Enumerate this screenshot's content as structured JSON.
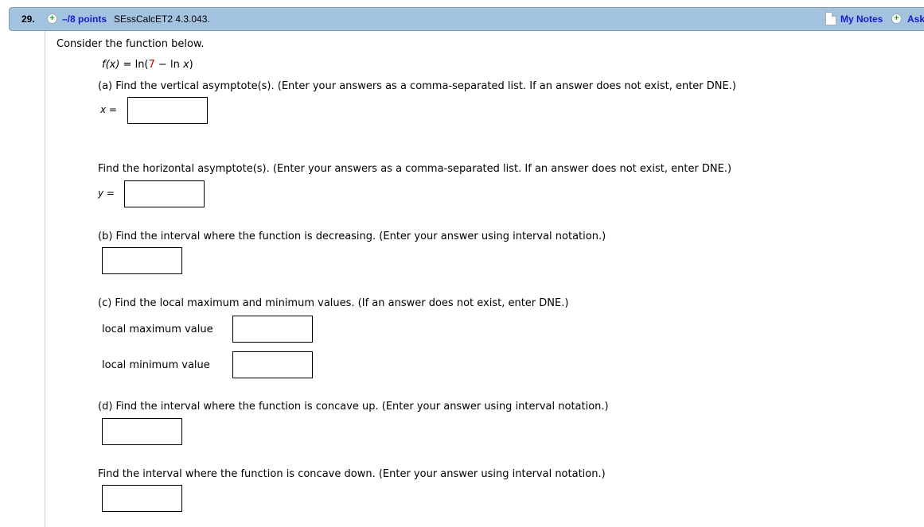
{
  "header": {
    "question_number": "29.",
    "points": "–/8 points",
    "source": "SEssCalcET2 4.3.043.",
    "my_notes_label": "My Notes",
    "ask_label": "Ask",
    "colors": {
      "header_bg": "#a3c3e0",
      "link": "#1a1acc",
      "plus_icon": "#2a9a2a"
    }
  },
  "problem": {
    "intro": "Consider the function below.",
    "function": {
      "lhs": "f(x)",
      "eq": " = ln(",
      "constant": "7",
      "rest": " − ln ",
      "var": "x",
      "close": ")"
    },
    "parts": {
      "a_vertical": {
        "prompt": "(a) Find the vertical asymptote(s). (Enter your answers as a comma-separated list. If an answer does not exist, enter DNE.)",
        "var_label": "x",
        "eq": " =",
        "value": ""
      },
      "a_horizontal": {
        "prompt": "Find the horizontal asymptote(s). (Enter your answers as a comma-separated list. If an answer does not exist, enter DNE.)",
        "var_label": "y",
        "eq": " =",
        "value": ""
      },
      "b_decreasing": {
        "prompt": "(b) Find the interval where the function is decreasing. (Enter your answer using interval notation.)",
        "value": ""
      },
      "c_extrema": {
        "prompt": "(c) Find the local maximum and minimum values. (If an answer does not exist, enter DNE.)",
        "max_label": "local maximum value",
        "max_value": "",
        "min_label": "local minimum value",
        "min_value": ""
      },
      "d_concave_up": {
        "prompt": "(d) Find the interval where the function is concave up. (Enter your answer using interval notation.)",
        "value": ""
      },
      "d_concave_down": {
        "prompt": "Find the interval where the function is concave down. (Enter your answer using interval notation.)",
        "value": ""
      }
    }
  }
}
